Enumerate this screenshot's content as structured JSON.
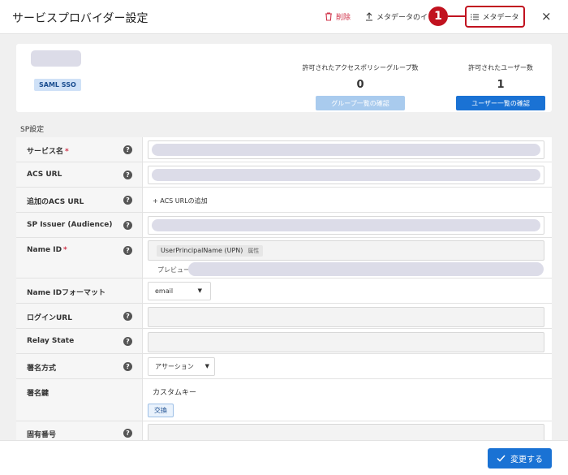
{
  "header": {
    "title": "サービスプロバイダー設定",
    "delete_label": "削除",
    "import_label": "メタデータのイ",
    "metadata_label": "メタデータ",
    "step_number": "1",
    "close_label": "×"
  },
  "summary": {
    "badge": "SAML SSO",
    "group_label": "許可されたアクセスポリシーグループ数",
    "group_count": "0",
    "group_button": "グループ一覧の確認",
    "user_label": "許可されたユーザー数",
    "user_count": "1",
    "user_button": "ユーザー一覧の確認"
  },
  "section_title": "SP設定",
  "form": {
    "service_name_label": "サービス名",
    "required_mark": "*",
    "acs_url_label": "ACS URL",
    "additional_acs_label": "追加のACS URL",
    "add_acs_link": "+ ACS URLの追加",
    "sp_issuer_label": "SP Issuer (Audience)",
    "name_id_label": "Name ID",
    "name_id_chip": "UserPrincipalName (UPN)",
    "name_id_chip_attr": "属性",
    "preview_label": "プレビュー:",
    "name_id_format_label": "Name IDフォーマット",
    "name_id_format_value": "email",
    "login_url_label": "ログインURL",
    "relay_state_label": "Relay State",
    "signature_method_label": "署名方式",
    "signature_method_value": "アサーション",
    "signing_key_label": "署名鍵",
    "signing_key_value": "カスタムキー",
    "exchange_button": "交換",
    "unique_number_label": "固有番号"
  },
  "footer": {
    "save_label": "変更する"
  },
  "icons": {
    "help": "question-circle-icon",
    "dropdown": "caret-down-icon",
    "delete": "trash-icon",
    "import": "upload-icon",
    "metadata": "list-icon",
    "check": "check-icon"
  }
}
